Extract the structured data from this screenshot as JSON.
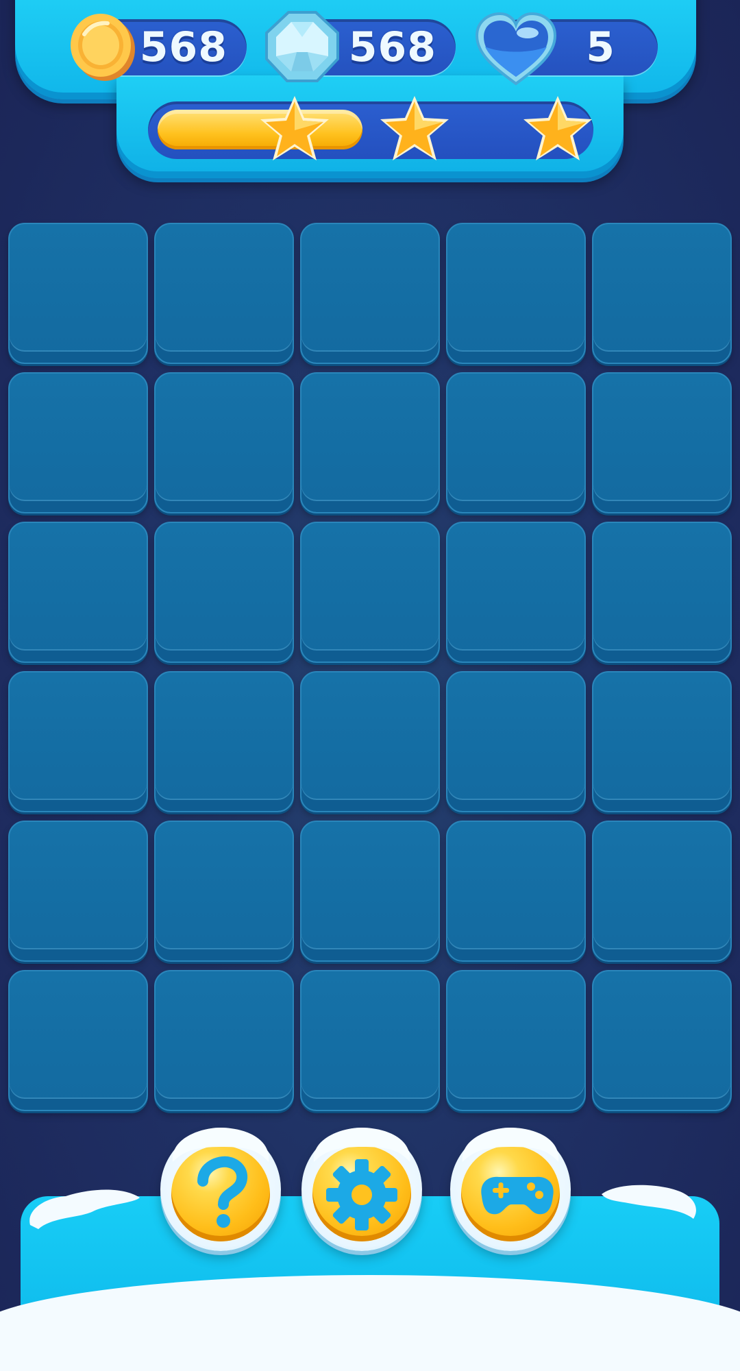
{
  "hud": {
    "coins": "568",
    "gems": "568",
    "lives": "5",
    "progress_fraction": 0.48,
    "stars": [
      "star",
      "star",
      "star"
    ]
  },
  "board": {
    "rows": 6,
    "columns": 5
  },
  "actions": [
    {
      "name": "help-button",
      "icon": "question-icon"
    },
    {
      "name": "settings-button",
      "icon": "gear-icon"
    },
    {
      "name": "games-button",
      "icon": "gamepad-icon"
    }
  ],
  "colors": {
    "background": "#1f2f63",
    "hud": "#1cc6f2",
    "tile": "#1470a6",
    "accent_yellow": "#ffc21f"
  }
}
